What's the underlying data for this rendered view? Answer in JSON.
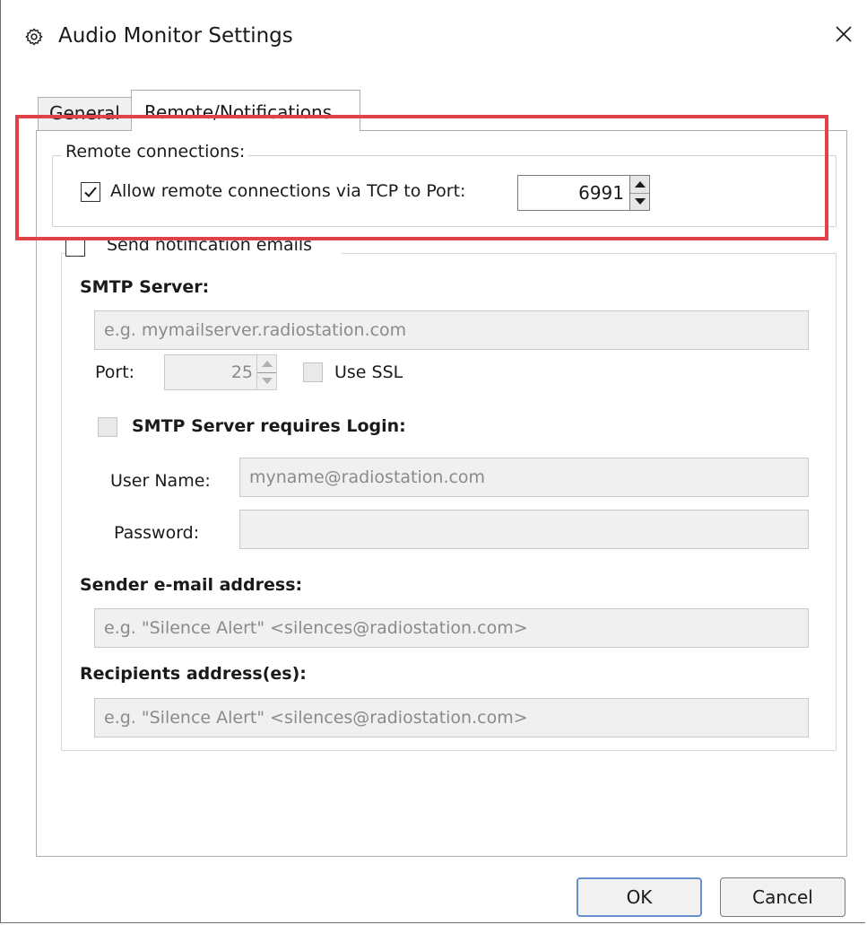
{
  "window": {
    "title": "Audio Monitor Settings"
  },
  "tabs": [
    {
      "label": "General"
    },
    {
      "label": "Remote/Notifications",
      "active": true
    }
  ],
  "remote": {
    "group_label": "Remote connections:",
    "allow_label": "Allow remote connections via TCP to Port:",
    "allow_checked": true,
    "port_value": "6991"
  },
  "notify": {
    "send_label": "Send notification emails",
    "send_checked": false,
    "smtp_server_label": "SMTP Server:",
    "smtp_server_placeholder": "e.g. mymailserver.radiostation.com",
    "port_label": "Port:",
    "port_value": "25",
    "use_ssl_label": "Use SSL",
    "requires_login_label": "SMTP Server requires Login:",
    "username_label": "User Name:",
    "username_placeholder": "myname@radiostation.com",
    "password_label": "Password:",
    "password_value": "",
    "sender_label": "Sender e-mail address:",
    "sender_placeholder": "e.g. \"Silence Alert\" <silences@radiostation.com>",
    "recipients_label": "Recipients address(es):",
    "recipients_placeholder": "e.g. \"Silence Alert\" <silences@radiostation.com>"
  },
  "buttons": {
    "ok": "OK",
    "cancel": "Cancel"
  },
  "icons": {
    "title_icon": "gear-icon",
    "close_icon": "close-icon"
  },
  "colors": {
    "highlight": "#e0424a",
    "ok_border": "#6a8fd0"
  }
}
